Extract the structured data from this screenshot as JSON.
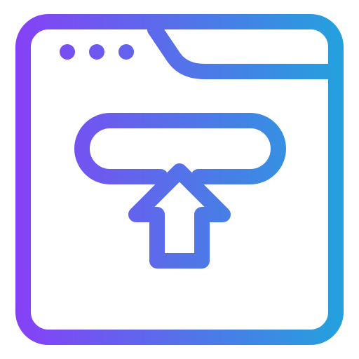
{
  "icon": {
    "name": "browser-upload-icon",
    "style": "outline",
    "gradient": {
      "start": "#8b3cf7",
      "end": "#1fa6dc"
    },
    "window_dots": 3
  }
}
